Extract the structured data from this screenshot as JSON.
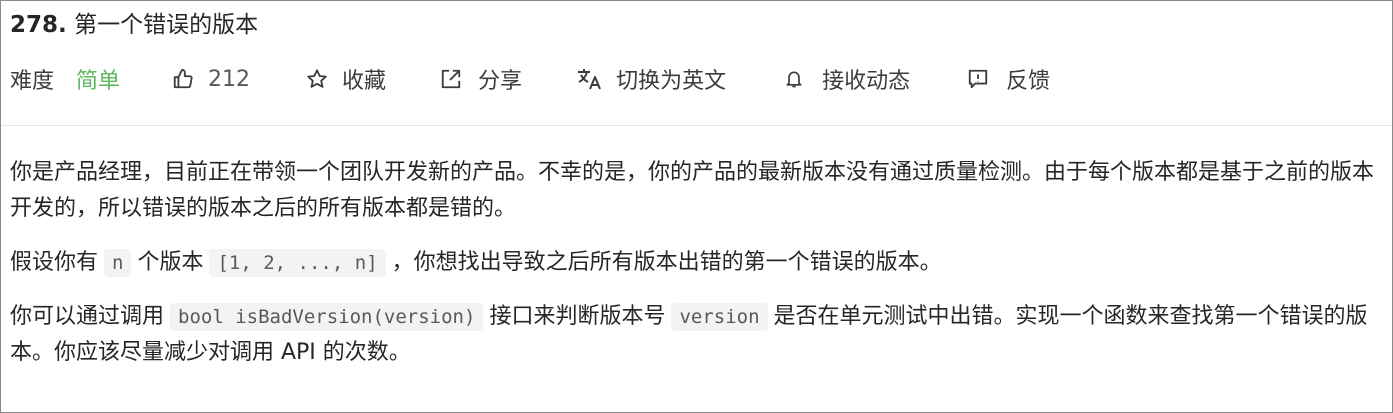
{
  "problem": {
    "number": "278.",
    "title": "第一个错误的版本"
  },
  "meta": {
    "difficulty_label": "难度",
    "difficulty_value": "简单",
    "difficulty_color": "#5cb85c",
    "likes_count": "212",
    "favorite_label": "收藏",
    "share_label": "分享",
    "switch_lang_label": "切换为英文",
    "notify_label": "接收动态",
    "feedback_label": "反馈",
    "icons": [
      "thumbs-up-icon",
      "star-icon",
      "share-icon",
      "translate-icon",
      "bell-icon",
      "feedback-icon"
    ]
  },
  "description": {
    "p1": "你是产品经理，目前正在带领一个团队开发新的产品。不幸的是，你的产品的最新版本没有通过质量检测。由于每个版本都是基于之前的版本开发的，所以错误的版本之后的所有版本都是错的。",
    "p2_a": "假设你有",
    "p2_code1": "n",
    "p2_b": "个版本",
    "p2_code2": "[1, 2, ..., n]",
    "p2_c": "，你想找出导致之后所有版本出错的第一个错误的版本。",
    "p3_a": "你可以通过调用",
    "p3_code1": "bool isBadVersion(version)",
    "p3_b": "接口来判断版本号",
    "p3_code2": "version",
    "p3_c": "是否在单元测试中出错。实现一个函数来查找第一个错误的版本。你应该尽量减少对调用 API 的次数。"
  }
}
